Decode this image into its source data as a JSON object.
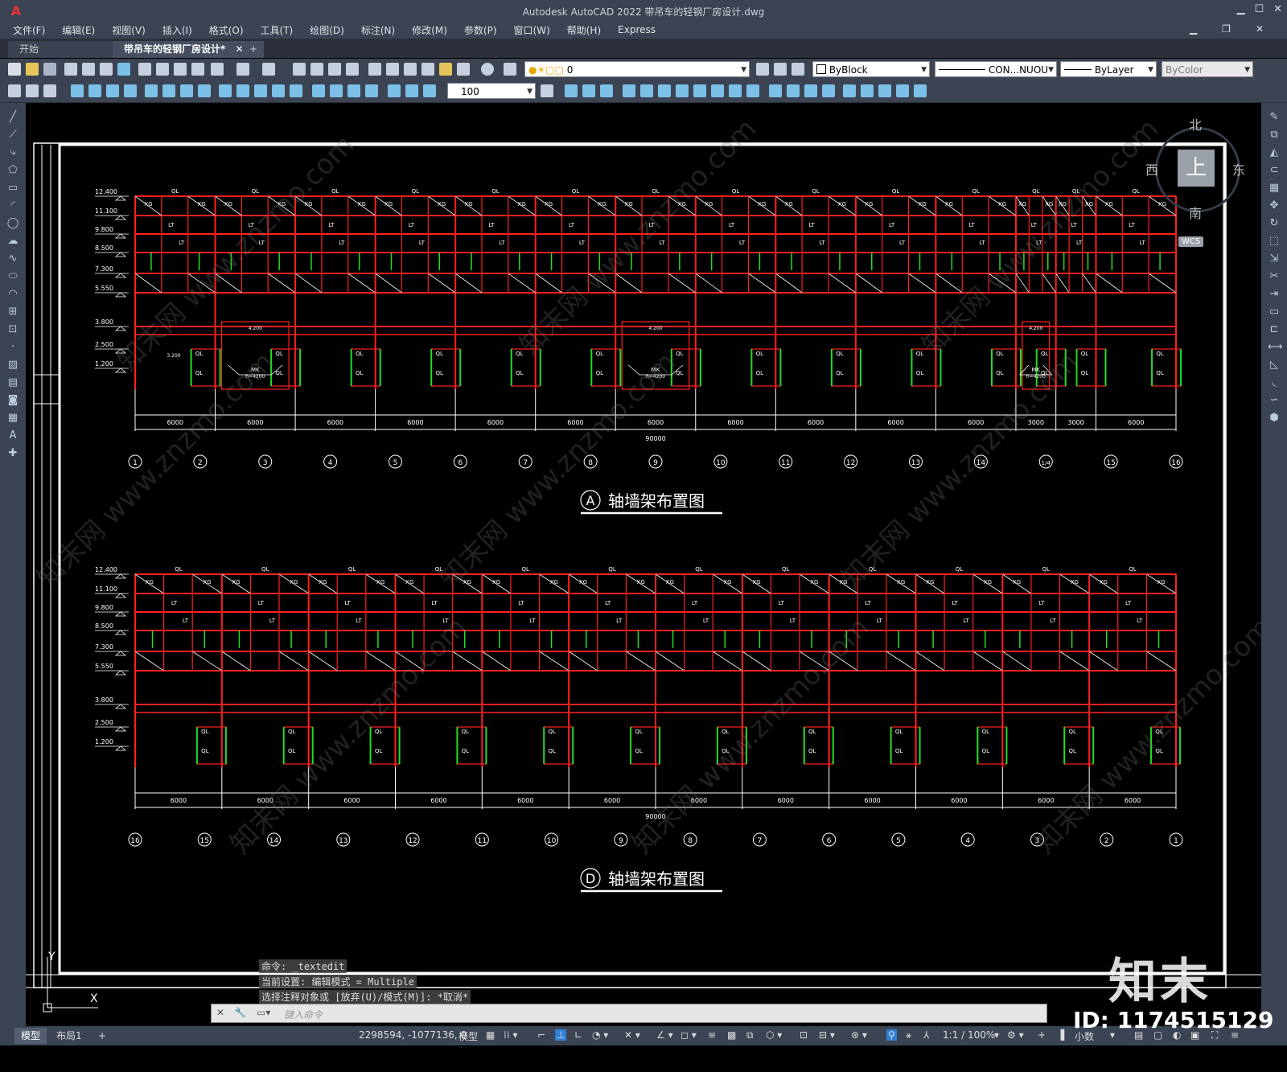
{
  "app": {
    "title": "Autodesk AutoCAD 2022    带吊车的轻钢厂房设计.dwg",
    "logo": "A"
  },
  "menu": [
    "文件(F)",
    "编辑(E)",
    "视图(V)",
    "插入(I)",
    "格式(O)",
    "工具(T)",
    "绘图(D)",
    "标注(N)",
    "修改(M)",
    "参数(P)",
    "窗口(W)",
    "帮助(H)",
    "Express"
  ],
  "tabs": {
    "start": "开始",
    "doc": "带吊车的轻钢厂房设计*",
    "add": "+"
  },
  "props": {
    "layer": "0",
    "color": "ByBlock",
    "linetype": "CON...NUOU",
    "lineweight": "ByLayer",
    "plotstyle": "ByColor",
    "scale": "100"
  },
  "viewcube": {
    "n": "北",
    "s": "南",
    "e": "东",
    "w": "西",
    "face": "上",
    "wcs": "WCS"
  },
  "drawing": {
    "levels": [
      "12.400",
      "11.100",
      "9.800",
      "8.500",
      "7.300",
      "5.550",
      "3.800",
      "2.500",
      "1.200"
    ],
    "top_axes": [
      "1",
      "2",
      "3",
      "4",
      "5",
      "6",
      "7",
      "8",
      "9",
      "10",
      "11",
      "12",
      "13",
      "14",
      "1/4",
      "15",
      "16"
    ],
    "bottom_axes": [
      "16",
      "15",
      "14",
      "13",
      "12",
      "11",
      "10",
      "9",
      "8",
      "7",
      "6",
      "5",
      "4",
      "3",
      "2",
      "1"
    ],
    "top_spans": [
      "6000",
      "6000",
      "6000",
      "6000",
      "6000",
      "6000",
      "6000",
      "6000",
      "6000",
      "6000",
      "6000",
      "3000",
      "3000",
      "6000"
    ],
    "bottom_spans": [
      "6000",
      "6000",
      "6000",
      "6000",
      "6000",
      "6000",
      "6000",
      "6000",
      "6000",
      "6000",
      "6000",
      "6000"
    ],
    "total": "90000",
    "top_title_axis": "A",
    "top_title": "轴墙架布置图",
    "bottom_title_axis": "D",
    "bottom_title": "轴墙架布置图",
    "member_ql": "QL",
    "member_xg": "XG",
    "member_lt": "LT",
    "door": "MK",
    "door_h": "h=4200",
    "door_level": "4.200",
    "small_level": "3.200",
    "ucs_y": "Y",
    "ucs_x": "X"
  },
  "command": {
    "history": [
      "命令: _textedit",
      "当前设置: 编辑模式 = Multiple",
      "选择注释对象或 [放弃(U)/模式(M)]: *取消*"
    ],
    "placeholder": "键入命令"
  },
  "status": {
    "model_tab": "模型",
    "layout_tab": "布局1",
    "add": "+",
    "coords": "2298594, -1077136, 0",
    "space": "模型",
    "scale": "1:1 / 100%",
    "units": "小数"
  },
  "brand": {
    "logo": "知末",
    "id": "ID: 1174515129"
  },
  "watermark": "知末网 www.znzmo.com"
}
